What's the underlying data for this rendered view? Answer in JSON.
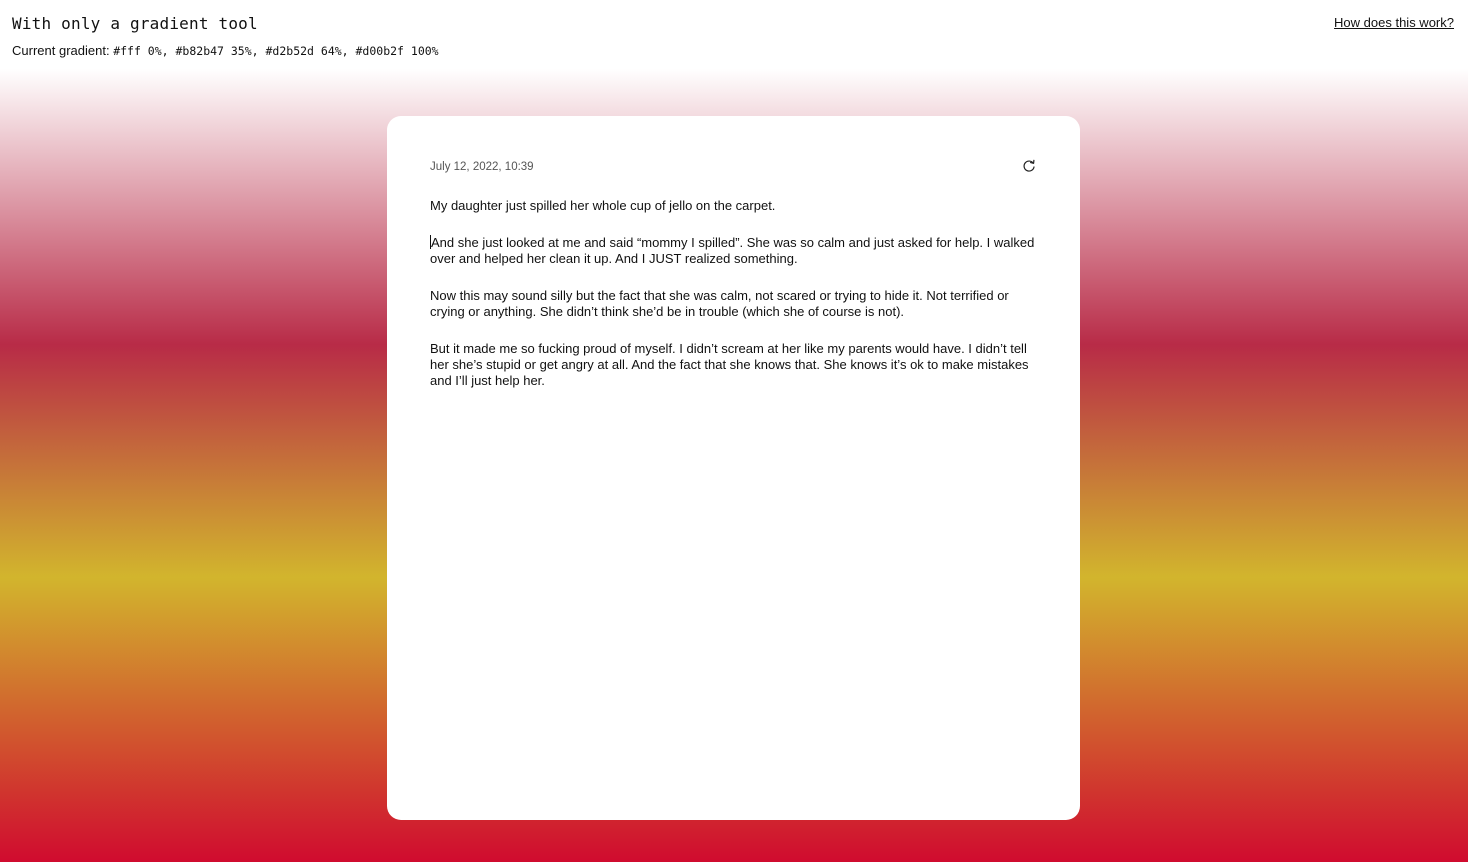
{
  "header": {
    "title": "With only a gradient tool",
    "gradient_label": "Current gradient:",
    "gradient_value": "#fff 0%, #b82b47 35%, #d2b52d 64%, #d00b2f 100%",
    "help_link": "How does this work?"
  },
  "card": {
    "timestamp": "July 12, 2022, 10:39",
    "refresh_icon": "refresh-icon",
    "paragraphs": [
      "My daughter just spilled her whole cup of jello on the carpet.",
      "And she just looked at me and said “mommy I spilled”. She was so calm and just asked for help. I walked over and helped her clean it up. And I JUST realized something.",
      "Now this may sound silly but the fact that she was calm, not scared or trying to hide it. Not terrified or crying or anything. She didn’t think she’d be in trouble (which she of course is not).",
      "But it made me so fucking proud of myself. I didn’t scream at her like my parents would have. I didn’t tell her she’s stupid or get angry at all. And the fact that she knows that. She knows it’s ok to make mistakes and I’ll just help her."
    ]
  },
  "colors": {
    "stop_0": "#ffffff",
    "stop_35": "#b82b47",
    "stop_64": "#d2b52d",
    "stop_100": "#d00b2f"
  }
}
